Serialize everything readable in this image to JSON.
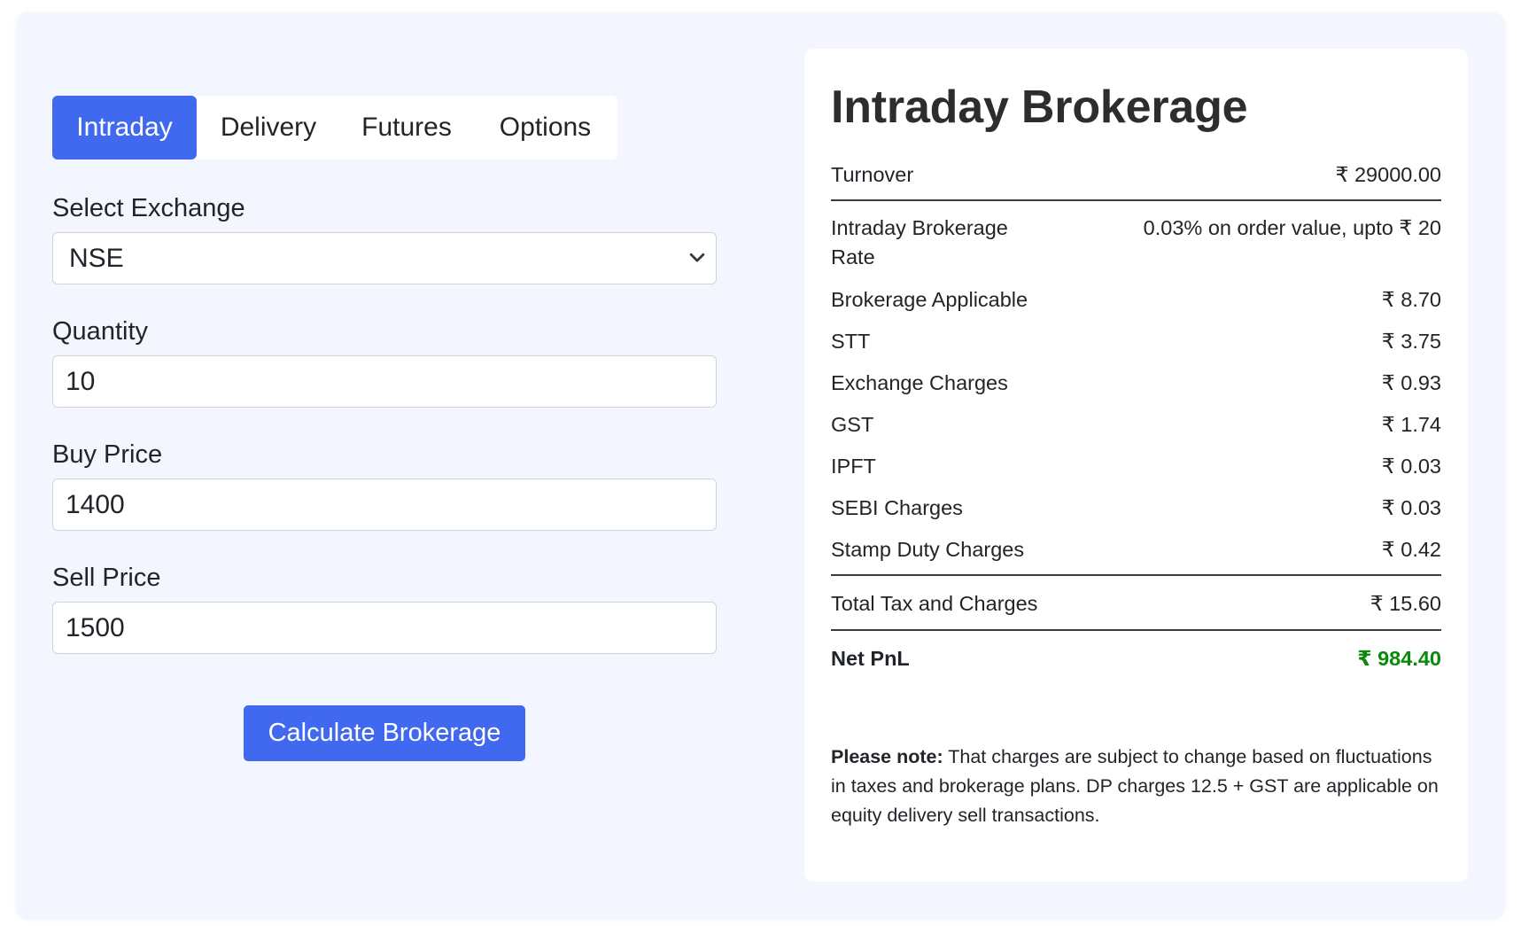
{
  "tabs": [
    {
      "label": "Intraday",
      "active": true
    },
    {
      "label": "Delivery",
      "active": false
    },
    {
      "label": "Futures",
      "active": false
    },
    {
      "label": "Options",
      "active": false
    }
  ],
  "form": {
    "exchange_label": "Select Exchange",
    "exchange_value": "NSE",
    "quantity_label": "Quantity",
    "quantity_value": "10",
    "buy_label": "Buy Price",
    "buy_value": "1400",
    "sell_label": "Sell Price",
    "sell_value": "1500",
    "calculate_label": "Calculate Brokerage"
  },
  "summary": {
    "title": "Intraday Brokerage",
    "turnover": {
      "label": "Turnover",
      "value": "₹ 29000.00"
    },
    "rate": {
      "label": "Intraday Brokerage Rate",
      "value": "0.03% on order value, upto ₹ 20"
    },
    "items": [
      {
        "label": "Brokerage Applicable",
        "value": "₹ 8.70"
      },
      {
        "label": "STT",
        "value": "₹ 3.75"
      },
      {
        "label": "Exchange Charges",
        "value": "₹ 0.93"
      },
      {
        "label": "GST",
        "value": "₹ 1.74"
      },
      {
        "label": "IPFT",
        "value": "₹ 0.03"
      },
      {
        "label": "SEBI Charges",
        "value": "₹ 0.03"
      },
      {
        "label": "Stamp Duty Charges",
        "value": "₹ 0.42"
      }
    ],
    "total": {
      "label": "Total Tax and Charges",
      "value": "₹ 15.60"
    },
    "net": {
      "label": "Net PnL",
      "value": "₹ 984.40"
    },
    "note_bold": "Please note:",
    "note_text": " That charges are subject to change based on fluctuations in taxes and brokerage plans. DP charges 12.5 + GST are applicable on equity delivery sell transactions."
  },
  "colors": {
    "accent": "#4169f0",
    "profit": "#0a8a0a",
    "background": "#f3f6fe"
  }
}
